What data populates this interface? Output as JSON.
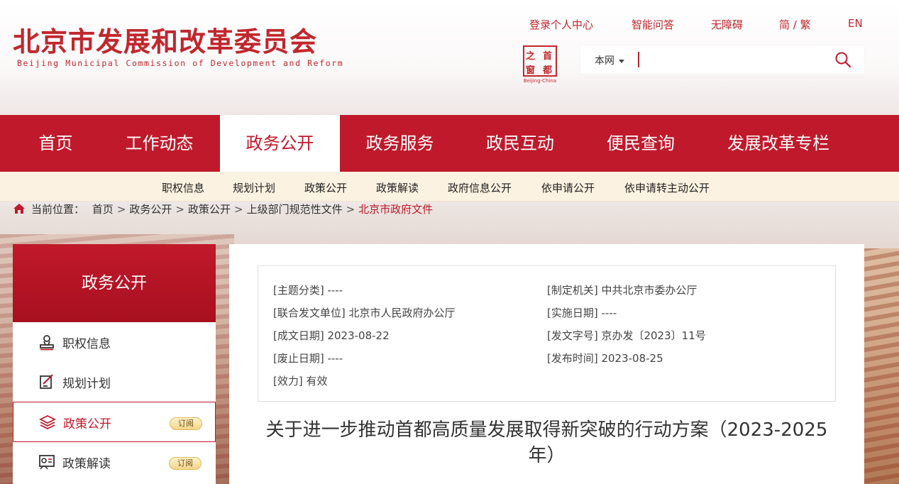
{
  "header": {
    "title": "北京市发展和改革委员会",
    "subtitle": "Beijing Municipal Commission of Development and Reform",
    "top_links": [
      "登录个人中心",
      "智能问答",
      "无障碍",
      "简 / 繁",
      "EN"
    ],
    "seal": {
      "chars": [
        "之",
        "首",
        "窗",
        "都"
      ],
      "caption": "Beijing-China"
    },
    "search": {
      "scope": "本网",
      "value": ""
    }
  },
  "main_nav": {
    "items": [
      "首页",
      "工作动态",
      "政务公开",
      "政务服务",
      "政民互动",
      "便民查询",
      "发展改革专栏"
    ],
    "active": "政务公开"
  },
  "sub_nav": {
    "items": [
      "职权信息",
      "规划计划",
      "政策公开",
      "政策解读",
      "政府信息公开",
      "依申请公开",
      "依申请转主动公开"
    ]
  },
  "breadcrumb": {
    "label": "当前位置：",
    "items": [
      "首页",
      "政务公开",
      "政策公开",
      "上级部门规范性文件"
    ],
    "current": "北京市政府文件"
  },
  "sidebar": {
    "title": "政务公开",
    "items": [
      {
        "label": "职权信息",
        "icon": "person-stamp-icon",
        "subscribe": ""
      },
      {
        "label": "规划计划",
        "icon": "edit-document-icon",
        "subscribe": ""
      },
      {
        "label": "政策公开",
        "icon": "layers-icon",
        "subscribe": "订阅"
      },
      {
        "label": "政策解读",
        "icon": "person-board-icon",
        "subscribe": "订阅"
      }
    ],
    "active": "政策公开"
  },
  "document": {
    "meta": {
      "topic": "[主题分类] ----",
      "issuer": "[制定机关] 中共北京市委办公厅",
      "co_issuer": "[联合发文单位] 北京市人民政府办公厅",
      "effective_date": "[实施日期] ----",
      "created_date": "[成文日期] 2023-08-22",
      "doc_number": "[发文字号] 京办发〔2023〕11号",
      "repeal_date": "[废止日期] ----",
      "publish_time": "[发布时间] 2023-08-25",
      "validity": "[效力] 有效"
    },
    "title": "关于进一步推动首都高质量发展取得新突破的行动方案（2023-2025年）"
  },
  "colors": {
    "brand_red": "#c0192b",
    "subnav_bg": "#fbf2e1"
  }
}
